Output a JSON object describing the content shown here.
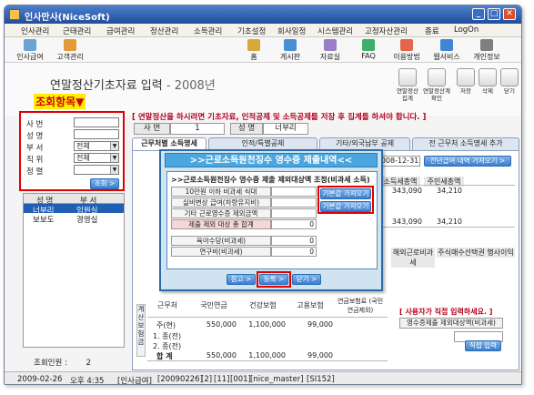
{
  "window": {
    "title": "인사만사(NiceSoft)"
  },
  "menu": [
    "인사관리",
    "근태관리",
    "급여관리",
    "정산관리",
    "소득관리",
    "기초설정",
    "회사일정",
    "시스템관리",
    "고정자산관리",
    "종료",
    "LogOn"
  ],
  "toolbar": {
    "left": [
      "인사급여",
      "고객관리"
    ],
    "right": [
      "홈",
      "게시판",
      "자료실",
      "FAQ",
      "이용방법",
      "웹서비스",
      "개인정보"
    ]
  },
  "page": {
    "title": "연말정산기초자료 입력",
    "year": "- 2008년",
    "tag": "조회항목▼",
    "notice": "[ 연말정산을 하시려면 기초자료, 인적공제 및 소득공제를 저장 후 집계를 하셔야 합니다. ]",
    "right_buttons": [
      "연말정산 집계",
      "연말정산계 확인",
      "저장",
      "삭제",
      "닫기"
    ]
  },
  "search": {
    "rows": [
      {
        "label": "사 번",
        "value": ""
      },
      {
        "label": "성 명",
        "value": ""
      },
      {
        "label": "부 서",
        "value": "전체"
      },
      {
        "label": "직 위",
        "value": "전체"
      },
      {
        "label": "정 렬",
        "value": ""
      }
    ],
    "search_button": "조회 >"
  },
  "list": {
    "headers": [
      "성 명",
      "부 서"
    ],
    "rows": [
      {
        "name": "너부리",
        "dept": "임원실"
      },
      {
        "name": "보보도",
        "dept": "경영실"
      }
    ],
    "count_label": "조회인원 :",
    "count_value": "2"
  },
  "employee": {
    "id_label": "사 번",
    "id": "1",
    "name_label": "성 명",
    "name": "너부리"
  },
  "tabs": [
    "근무처별 소득명세",
    "인적/특별공제",
    "기타/외국납부 공제",
    "전 근무처 소득명세 추가"
  ],
  "content": {
    "date": "2008-12-31",
    "import_btn": "전년급여 내역 가져오기 >",
    "col_income_tax": "소득세총액",
    "col_resident_tax": "주민세총액",
    "income_tax_values": [
      "343,090",
      "343,090"
    ],
    "resident_tax_values": [
      "34,210",
      "34,210"
    ],
    "col_overseas": "해외근로비과세",
    "col_overtime": "주식매수선택권 행사이익",
    "ins_headers": [
      "근무처",
      "국민연금",
      "건강보험",
      "고용보험",
      "연금보험료 (국민연금제외)"
    ],
    "ins_side_label": "계산 보험 금",
    "ins_rows": [
      {
        "label": "주(현)",
        "pension": "550,000",
        "health": "1,100,000",
        "employ": "99,000",
        "annuity": ""
      },
      {
        "label": "1. 종(전)",
        "pension": "",
        "health": "",
        "employ": "",
        "annuity": ""
      },
      {
        "label": "2. 종(전)",
        "pension": "",
        "health": "",
        "employ": "",
        "annuity": ""
      },
      {
        "label": "합 계",
        "pension": "550,000",
        "health": "1,100,000",
        "employ": "99,000",
        "annuity": ""
      }
    ],
    "self_notice": "[ 사용자가 직접 입력하세요. ]",
    "self_item": "영수증제출 제외대상액(비과세)",
    "direct_btn": "직접 입력 >"
  },
  "dialog": {
    "title": ">>근로소득원천징수 영수증 제출내역<<",
    "subtitle": ">>근로소득원천징수 영수증 제출 제외대상액 조정(비과세 소득)",
    "rows": [
      {
        "label": "10만원 이하 비과세 식대",
        "value": ""
      },
      {
        "label": "실비변상 급여(차량유지비)",
        "value": ""
      },
      {
        "label": "기타 근로영수증 제외금액",
        "value": ""
      },
      {
        "label": "제출 제외 대상 총 합계",
        "value": "0"
      },
      {
        "label": "육아수당(비과세)",
        "value": "0"
      },
      {
        "label": "연구비(비과세)",
        "value": "0"
      }
    ],
    "fetch_buttons": [
      "기본값 가져오기 >",
      "기본값 가져오기 >"
    ],
    "footer_buttons": [
      "참고 >",
      "등록 >",
      "닫기 >"
    ]
  },
  "status": [
    "2009-02-26",
    "오후 4:35",
    "[인사급여]",
    "[20090226]",
    "[2]",
    "[11]",
    "[001]",
    "[nice_master]",
    "[SI152]"
  ]
}
